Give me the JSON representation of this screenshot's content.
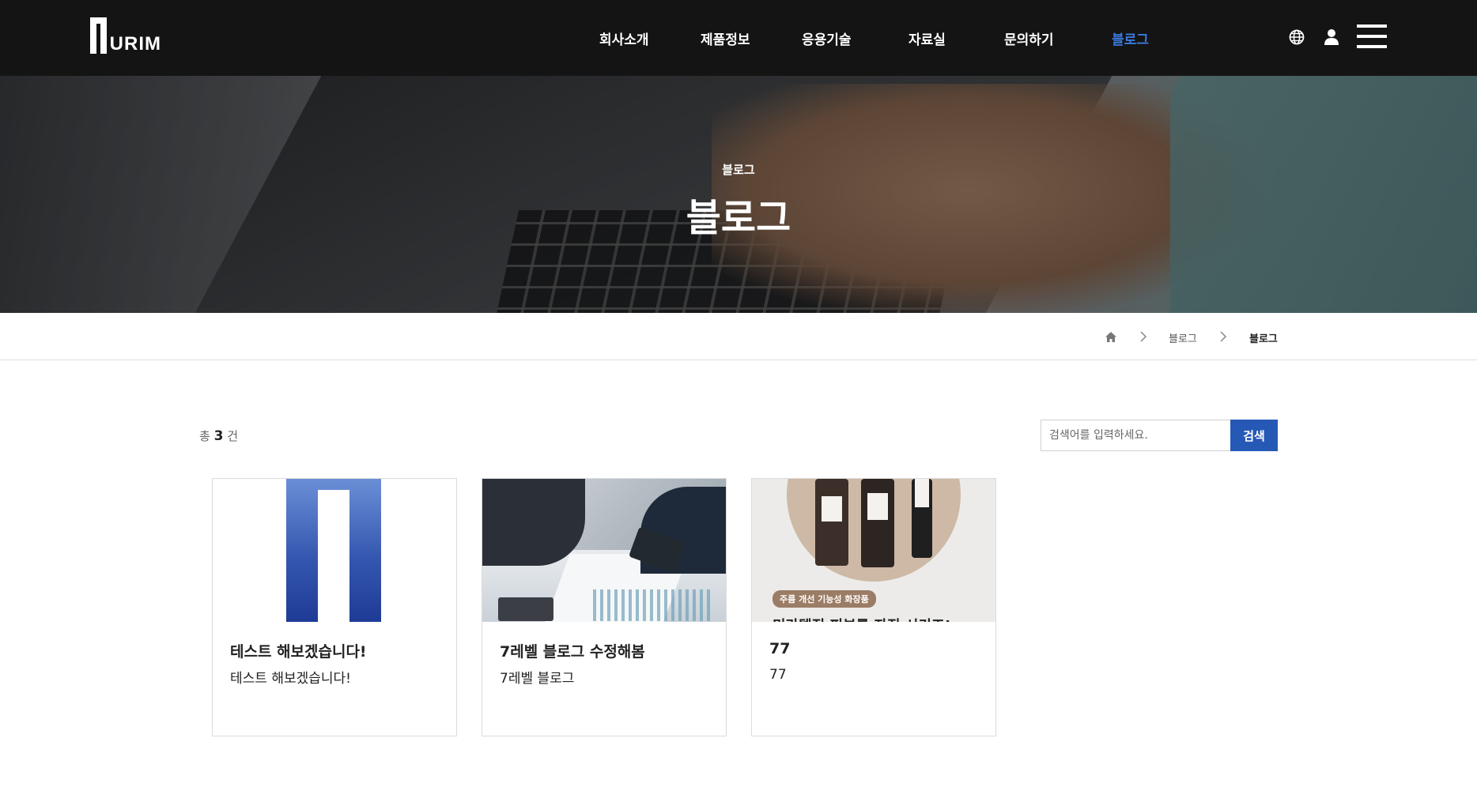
{
  "header": {
    "logo_text": "URIM",
    "nav": [
      "회사소개",
      "제품정보",
      "응용기술",
      "자료실",
      "문의하기",
      "블로그"
    ],
    "active_nav": "블로그",
    "icons": [
      "globe-icon",
      "user-icon",
      "hamburger-menu-icon"
    ],
    "accent_color": "#3a7be0"
  },
  "hero": {
    "subtitle": "블로그",
    "title": "블로그"
  },
  "breadcrumb": {
    "items": [
      "블로그",
      "블로그"
    ]
  },
  "list": {
    "total_prefix": "총",
    "total_count": "3",
    "total_suffix": "건",
    "search_placeholder": "검색어를 입력하세요.",
    "search_button": "검색",
    "search_button_color": "#2659b6"
  },
  "cards": [
    {
      "title": "테스트 해보겠습니다!",
      "description": "테스트 해보겠습니다!"
    },
    {
      "title": "7레벨 블로그 수정해봄",
      "description": "7레벨 블로그"
    },
    {
      "title": "77",
      "description": "77",
      "image_badge": "주름 개선 기능성 화장품",
      "image_caption": "미라텔진 피부를 자진 시키즈!"
    }
  ]
}
